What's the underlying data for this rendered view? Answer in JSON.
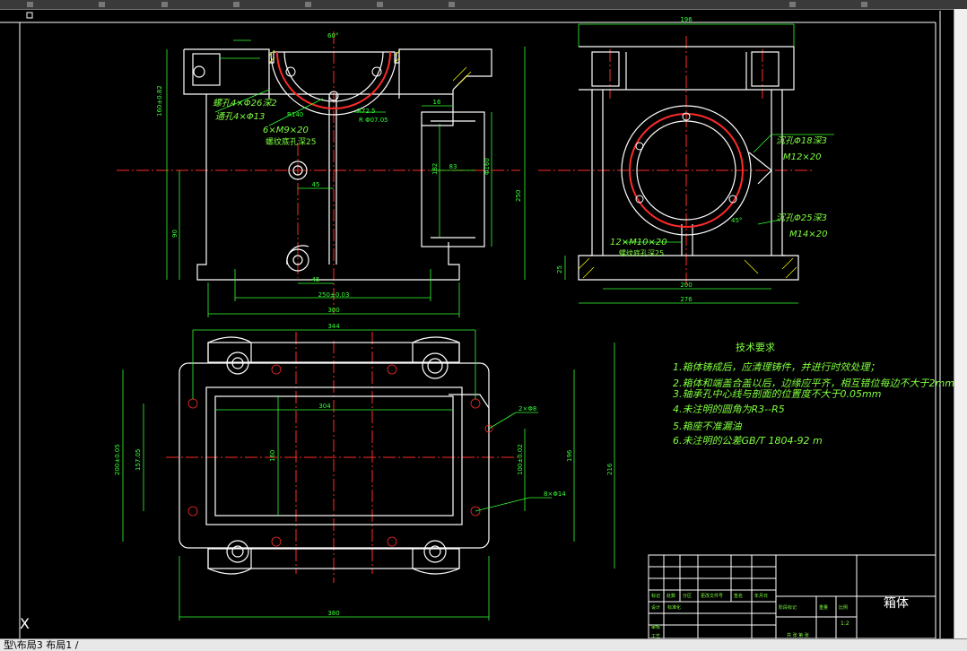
{
  "layout_tabs": "型\\布局3 布局1 /",
  "ucs_icon": "X",
  "tech_requirements": {
    "title": "技术要求",
    "items": [
      "1.箱体铸成后，应清理铸件，并进行时效处理；",
      "2.箱体和端盖合盖以后，边缘应平齐，相互错位每边不大于2mm",
      "3.轴承孔中心线与剖面的位置度不大于0.05mm",
      "4.未注明的圆角为R3--R5",
      "5.箱座不准漏油",
      "6.未注明的公差GB/T 1804-92 m"
    ]
  },
  "front_view_notes": {
    "holes1": "螺孔4×Φ26深2",
    "holes2": "通孔4×Φ13",
    "thread": "6×M9×20",
    "thread_depth": "螺纹底孔深25",
    "r140": "R140",
    "r72": "R72.5",
    "r_dia": "R Φ07.05",
    "ang": "60°"
  },
  "side_view_notes": {
    "n1": "沉孔Φ18深3",
    "n2": "M12×20",
    "n3": "沉孔Φ25深3",
    "n4": "M14×20",
    "n5": "12×M10×20",
    "n6": "螺纹底孔深25",
    "ang": "45°"
  },
  "dimensions": {
    "d300": "300",
    "d250": "250±0.03",
    "d45a": "45",
    "d45b": "45",
    "d16": "16",
    "d83": "83",
    "d182": "182",
    "d160": "Φ160",
    "d160_82": "160±0.82",
    "d90": "90",
    "d196": "196",
    "d250v": "250",
    "d200": "200",
    "d276": "276",
    "d25": "25",
    "d344": "344",
    "d304": "304",
    "d380": "380",
    "d160b": "160",
    "d200_05": "200±0.05",
    "d157": "157.05",
    "d196b": "196",
    "d216": "216",
    "d100": "100±0.02",
    "d2x8": "2×Φ8",
    "d8x14": "8×Φ14"
  },
  "title_block": {
    "part_name": "箱体",
    "labels": [
      "标记",
      "处数",
      "分区",
      "更改文件号",
      "签名",
      "年月日",
      "设计",
      "标准化",
      "阶段标记",
      "重量",
      "比例",
      "审核",
      "工艺",
      "共  张  第  张"
    ],
    "scale": "1:2"
  },
  "colors": {
    "outline": "#ffffff",
    "center": "#ff2a2a",
    "dim": "#33ff33",
    "hatch": "#ffff00",
    "note": "#7fff3f"
  }
}
